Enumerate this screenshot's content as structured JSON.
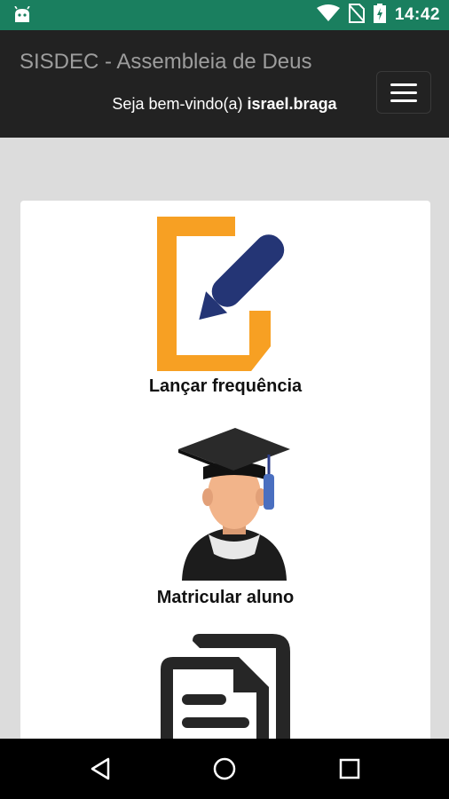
{
  "status_bar": {
    "time": "14:42",
    "colors": {
      "background": "#1a7f5f"
    }
  },
  "navbar": {
    "brand": "SISDEC - Assembleia de Deus",
    "welcome_prefix": "Seja bem-vindo(a)",
    "username": "israel.braga"
  },
  "menu": [
    {
      "label": "Lançar frequência",
      "icon": "edit-document-icon"
    },
    {
      "label": "Matricular aluno",
      "icon": "graduate-student-icon"
    },
    {
      "label": "",
      "icon": "documents-icon"
    }
  ],
  "colors": {
    "navbar": "#222222",
    "accent_orange": "#f7a023",
    "accent_blue": "#243575"
  }
}
